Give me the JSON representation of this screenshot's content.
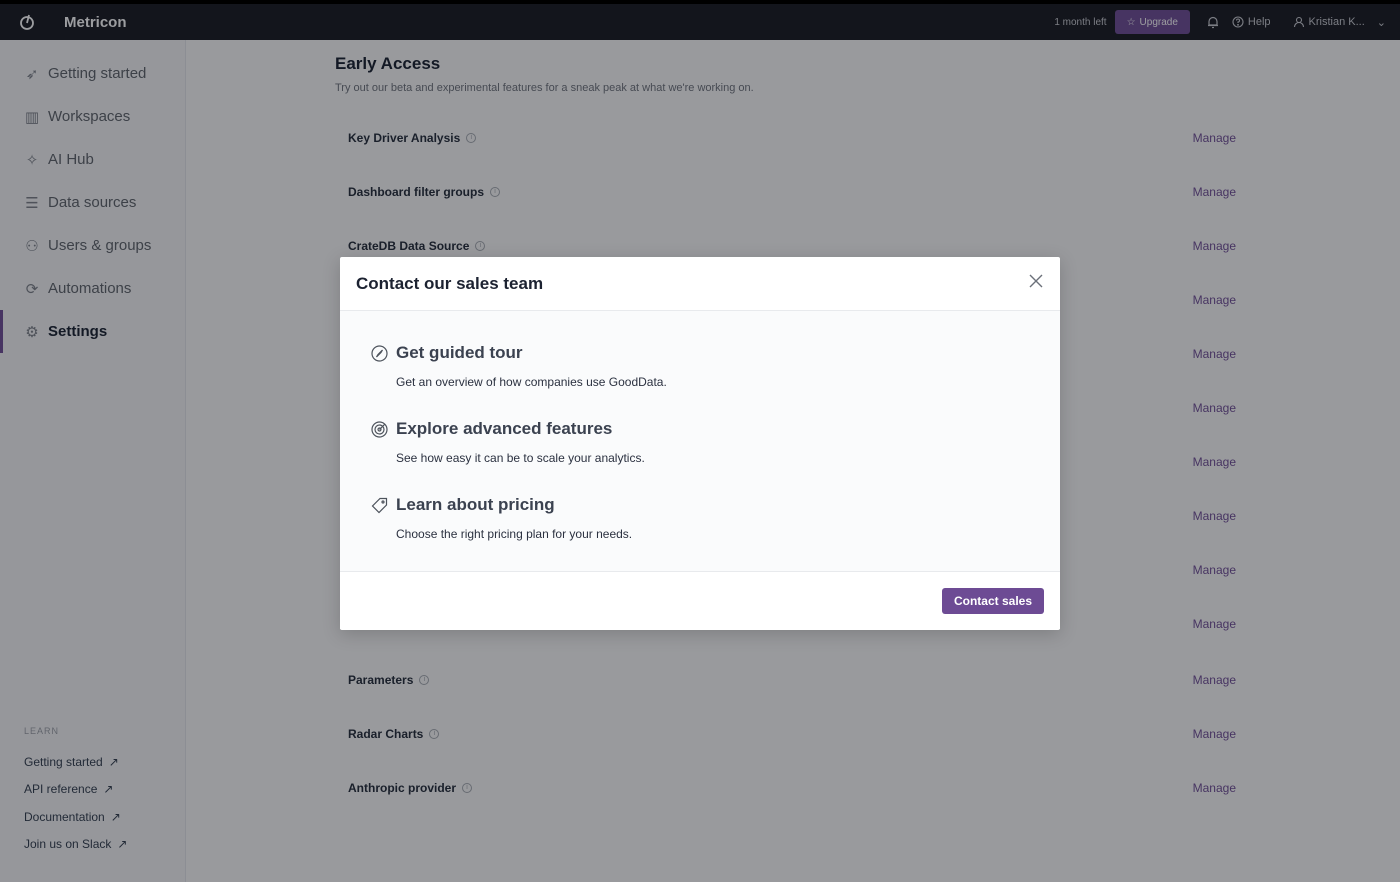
{
  "topbar": {
    "brand": "Metricon",
    "trial": "1 month left",
    "upgrade": "Upgrade",
    "help": "Help",
    "user": "Kristian K..."
  },
  "sidebar": {
    "items": [
      {
        "label": "Getting started",
        "icon": "rocket-icon"
      },
      {
        "label": "Workspaces",
        "icon": "workspace-icon"
      },
      {
        "label": "AI Hub",
        "icon": "sparkle-icon"
      },
      {
        "label": "Data sources",
        "icon": "database-icon"
      },
      {
        "label": "Users & groups",
        "icon": "users-icon"
      },
      {
        "label": "Automations",
        "icon": "automation-icon"
      },
      {
        "label": "Settings",
        "icon": "gear-icon",
        "active": true
      }
    ],
    "learn_heading": "LEARN",
    "learn_links": [
      "Getting started",
      "API reference",
      "Documentation",
      "Join us on Slack"
    ]
  },
  "main": {
    "title": "Early Access",
    "subtitle": "Try out our beta and experimental features for a sneak peak at what we're working on.",
    "manage_label": "Manage",
    "features": [
      "Key Driver Analysis",
      "Dashboard filter groups",
      "CrateDB Data Source",
      "",
      "",
      "",
      "",
      "",
      "",
      "",
      "Parameters",
      "Radar Charts",
      "Anthropic provider"
    ]
  },
  "modal": {
    "title": "Contact our sales team",
    "options": [
      {
        "title": "Get guided tour",
        "desc": "Get an overview of how companies use GoodData.",
        "icon": "compass-icon"
      },
      {
        "title": "Explore advanced features",
        "desc": "See how easy it can be to scale your analytics.",
        "icon": "target-icon"
      },
      {
        "title": "Learn about pricing",
        "desc": "Choose the right pricing plan for your needs.",
        "icon": "tag-icon"
      }
    ],
    "cta": "Contact sales"
  },
  "colors": {
    "accent": "#6d4b94",
    "topbar": "#14161c"
  }
}
